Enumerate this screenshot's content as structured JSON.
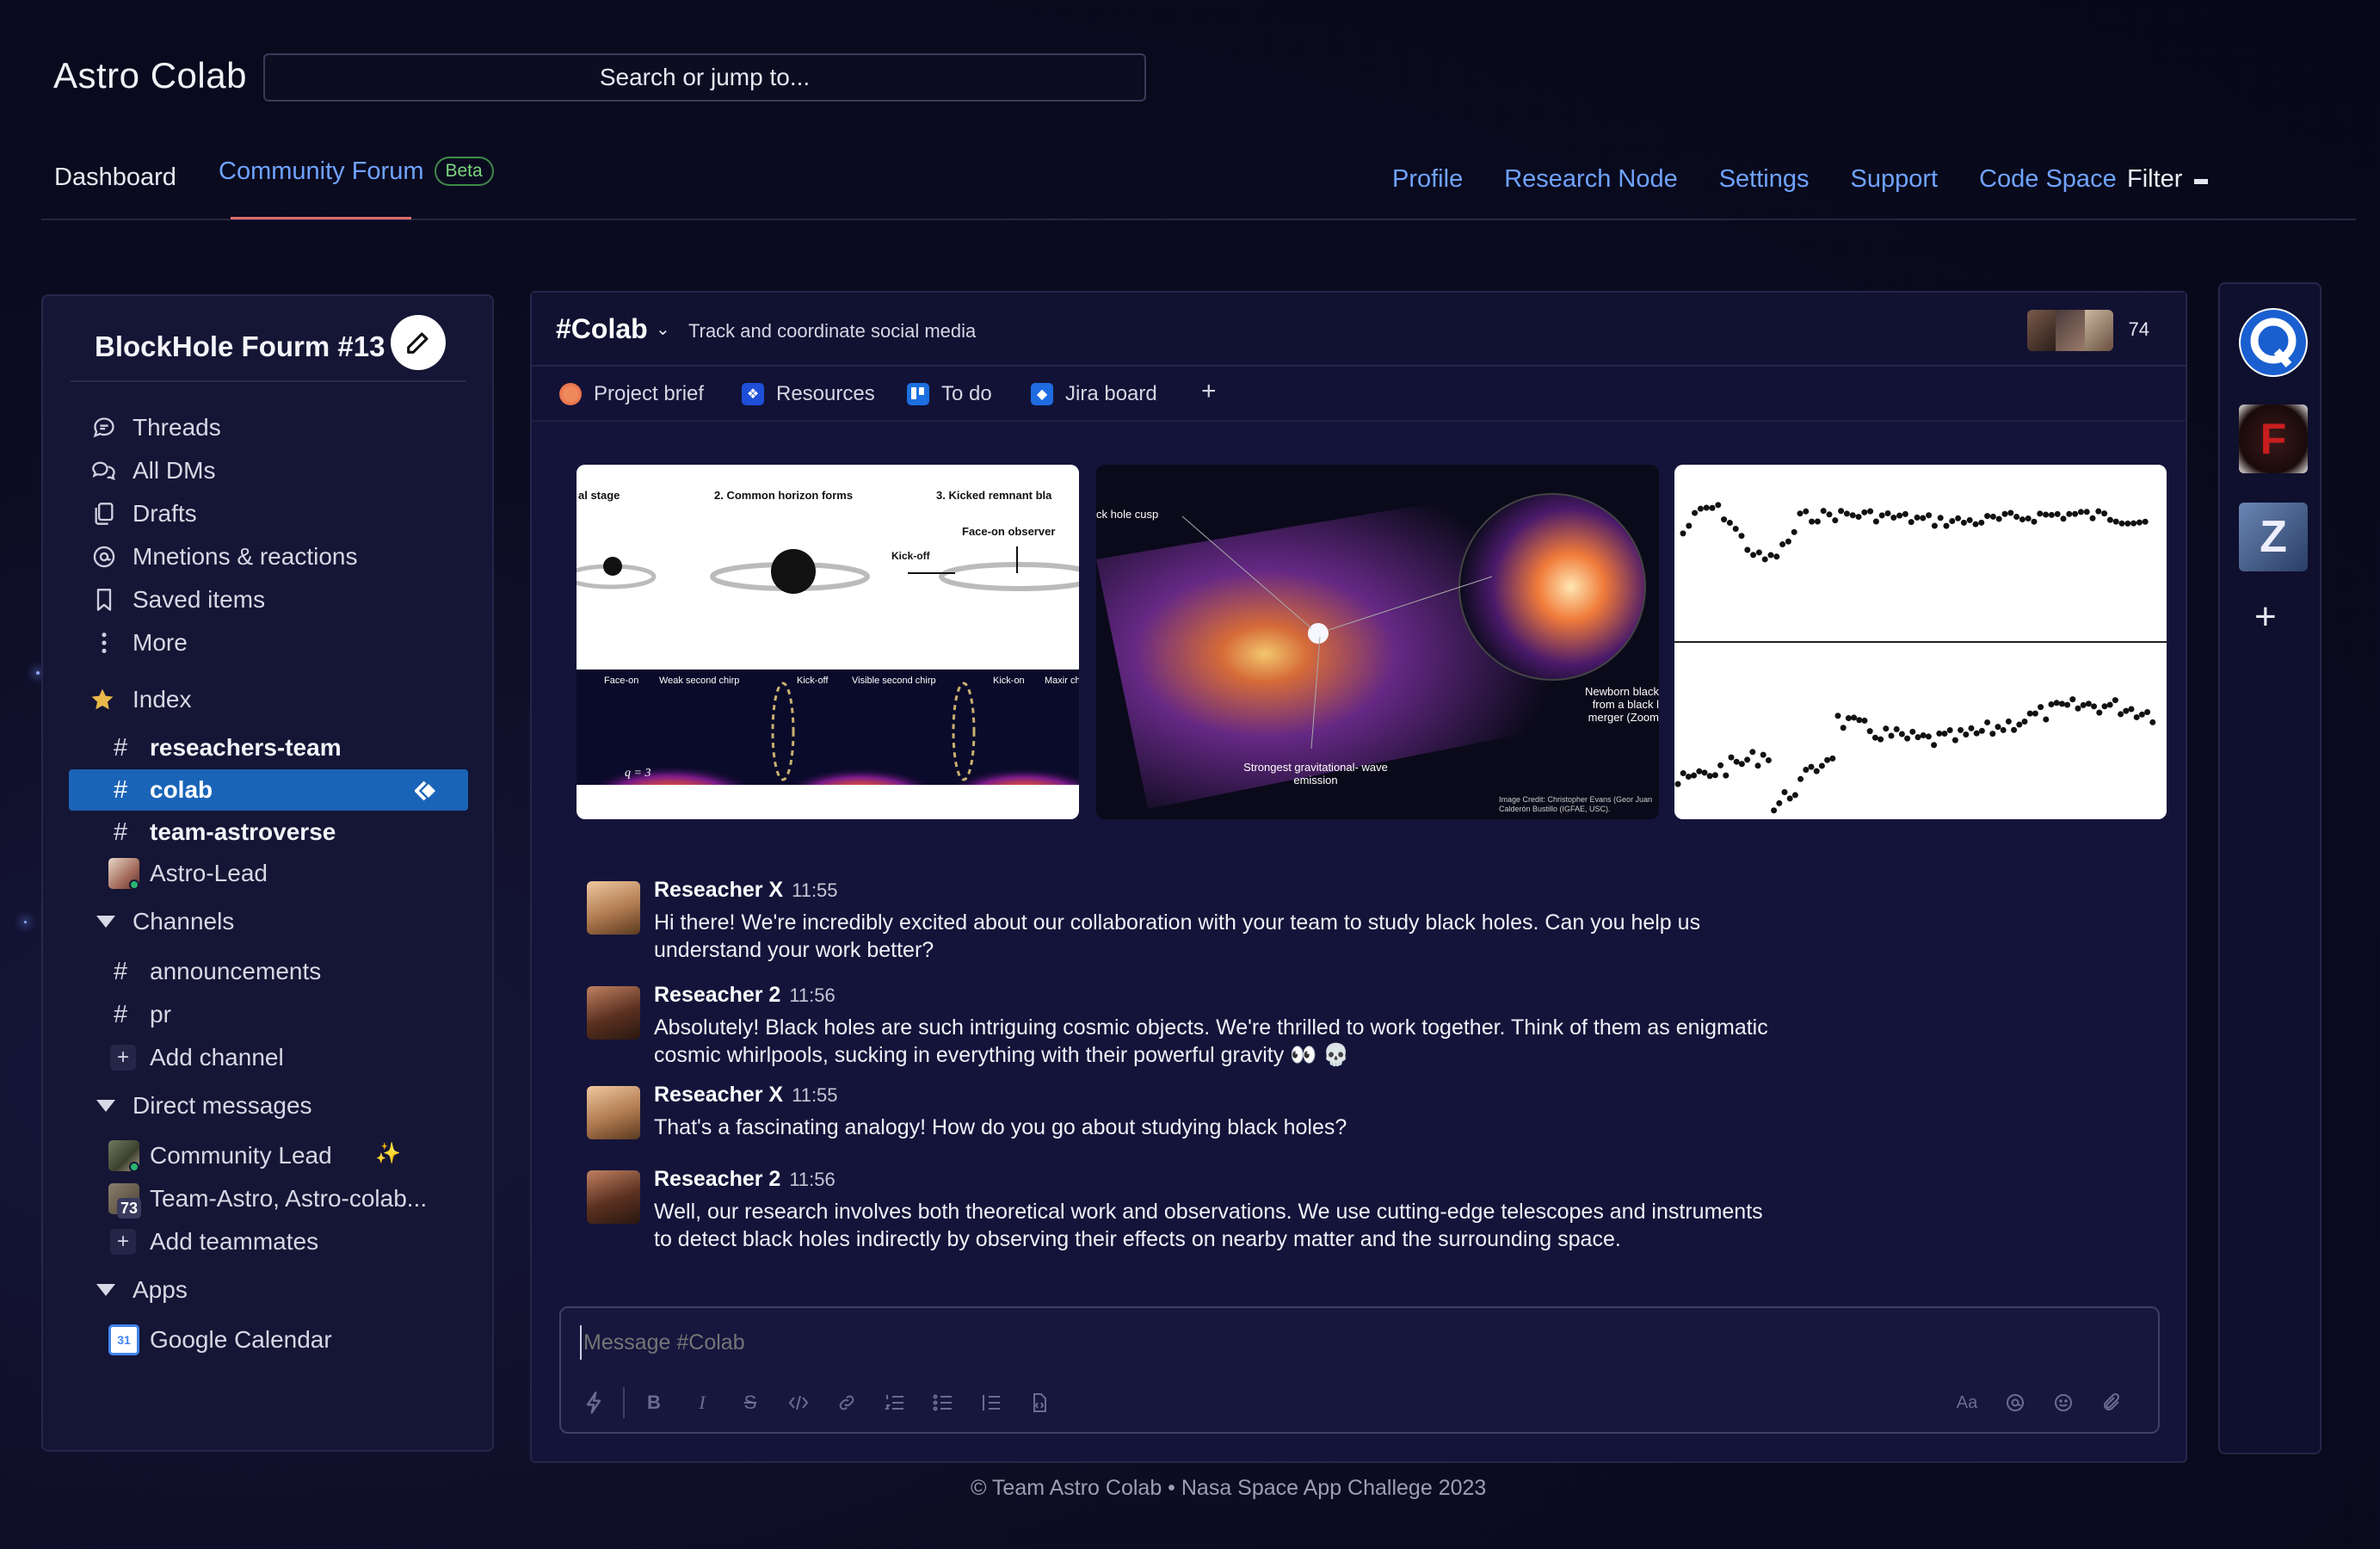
{
  "app": {
    "title": "Astro Colab",
    "search_placeholder": "Search or jump to..."
  },
  "nav": {
    "dashboard": "Dashboard",
    "forum": "Community Forum",
    "forum_badge": "Beta",
    "right": [
      "Profile",
      "Research Node",
      "Settings",
      "Support",
      "Code Space"
    ],
    "filter": "Filter"
  },
  "sidebar": {
    "workspace": "BlockHole Fourm #13",
    "items": [
      "Threads",
      "All DMs",
      "Drafts",
      "Mnetions & reactions",
      "Saved items",
      "More"
    ],
    "index_label": "Index",
    "starred_channels": [
      "reseachers-team",
      "colab",
      "team-astroverse"
    ],
    "starred_dm": "Astro-Lead",
    "channels_header": "Channels",
    "channels": [
      "announcements",
      "pr"
    ],
    "add_channel": "Add channel",
    "dms_header": "Direct messages",
    "dms": [
      "Community Lead",
      "Team-Astro, Astro-colab..."
    ],
    "dm_badge": "73",
    "add_teammates": "Add teammates",
    "apps_header": "Apps",
    "apps": [
      "Google Calendar"
    ]
  },
  "channel": {
    "name": "#Colab",
    "topic": "Track and coordinate social media",
    "member_count": "74",
    "tabs": [
      "Project brief",
      "Resources",
      "To do",
      "Jira board"
    ],
    "tab_add": "+"
  },
  "images": {
    "img1_labels": [
      "al stage",
      "2. Common horizon forms",
      "3. Kicked remnant  bla",
      "Face-on observer",
      "Kick-off",
      "Face-on",
      "Weak second chirp",
      "Kick-off",
      "Visible second chirp",
      "Kick-on",
      "Maxir chirp",
      "q = 3"
    ],
    "img2_labels": [
      "ck hole cusp",
      "Newborn black from a black l merger (Zoom",
      "Strongest gravitational- wave emission",
      "Image Credit: Christopher Evans (Geor Juan Calderón Bustillo (IGFAE, USC)."
    ]
  },
  "messages": [
    {
      "author": "Reseacher X",
      "time": "11:55",
      "text": "Hi there! We're incredibly excited about our collaboration with your team to study black holes. Can you help us understand your work better?"
    },
    {
      "author": "Reseacher 2",
      "time": "11:56",
      "text": " Absolutely! Black holes are such intriguing cosmic objects. We're thrilled to work together. Think of them as enigmatic cosmic whirlpools, sucking in everything with their powerful gravity 👀 💀"
    },
    {
      "author": "Reseacher X",
      "time": "11:55",
      "text": "That's a fascinating analogy! How do you go about studying black holes?"
    },
    {
      "author": "Reseacher 2",
      "time": "11:56",
      "text": "Well, our research involves both theoretical work and observations. We use cutting-edge telescopes and instruments to detect black holes indirectly by observing their effects on nearby matter and the surrounding space."
    }
  ],
  "composer": {
    "placeholder": "Message #Colab",
    "format_label": "Aa"
  },
  "footer": "© Team Astro Colab • Nasa Space App Challege 2023",
  "colors": {
    "accent": "#6fa3ff",
    "active_item": "#1a64b8",
    "beta": "#7ad67f",
    "underline": "#e06d6d"
  }
}
